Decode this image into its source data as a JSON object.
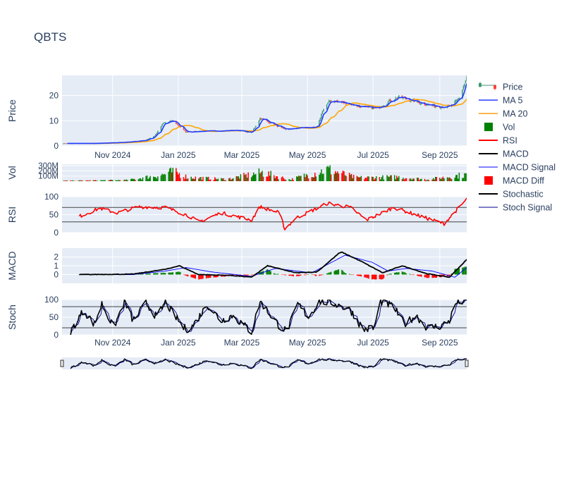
{
  "title": "QBTS",
  "colors": {
    "plot_bg": "#e5ecf6",
    "grid": "#ffffff",
    "text": "#2a3f5f",
    "up": "#3d9970",
    "down": "#ff4136",
    "ma5": "#1f3cff",
    "ma20": "#ffa500",
    "vol_up": "#008000",
    "vol_down": "#ff0000",
    "rsi": "#ff0000",
    "macd": "#000000",
    "macd_signal": "#0000ff",
    "stoch": "#000000",
    "stoch_signal": "#00008b"
  },
  "x_tick_labels": [
    "Nov 2024",
    "Jan 2025",
    "Mar 2025",
    "May 2025",
    "Jul 2025",
    "Sep 2025"
  ],
  "panels": {
    "price": {
      "ylabel": "Price",
      "ylim": [
        0,
        28
      ],
      "ticks": [
        {
          "v": 0,
          "label": "0"
        },
        {
          "v": 10,
          "label": "10"
        },
        {
          "v": 20,
          "label": "20"
        }
      ]
    },
    "vol": {
      "ylabel": "Vol",
      "ylim": [
        0,
        330
      ],
      "ticks": [
        {
          "v": 100,
          "label": "100M"
        },
        {
          "v": 200,
          "label": "200M"
        },
        {
          "v": 300,
          "label": "300M"
        }
      ]
    },
    "rsi": {
      "ylabel": "RSI",
      "ylim": [
        0,
        100
      ],
      "ticks": [
        {
          "v": 0,
          "label": "0"
        },
        {
          "v": 50,
          "label": "50"
        },
        {
          "v": 100,
          "label": "100"
        }
      ],
      "hlines": [
        30,
        70
      ]
    },
    "macd": {
      "ylabel": "MACD",
      "ylim": [
        -1,
        3
      ],
      "ticks": [
        {
          "v": 0,
          "label": "0"
        },
        {
          "v": 1,
          "label": "1"
        },
        {
          "v": 2,
          "label": "2"
        }
      ]
    },
    "stoch": {
      "ylabel": "Stoch",
      "ylim": [
        0,
        100
      ],
      "ticks": [
        {
          "v": 0,
          "label": "0"
        },
        {
          "v": 50,
          "label": "50"
        },
        {
          "v": 100,
          "label": "100"
        }
      ],
      "hlines": [
        20,
        80
      ]
    }
  },
  "legend": [
    {
      "label": "Price",
      "kind": "candle"
    },
    {
      "label": "MA 5",
      "kind": "line",
      "color": "#5a6cff",
      "width": 2
    },
    {
      "label": "MA 20",
      "kind": "line",
      "color": "#ffb34d",
      "width": 2
    },
    {
      "label": "Vol",
      "kind": "box",
      "color": "#008000"
    },
    {
      "label": "RSI",
      "kind": "line",
      "color": "#ff0000",
      "width": 2
    },
    {
      "label": "MACD",
      "kind": "line",
      "color": "#000000",
      "width": 2
    },
    {
      "label": "MACD Signal",
      "kind": "line",
      "color": "#0000ff",
      "width": 1
    },
    {
      "label": "MACD Diff",
      "kind": "box",
      "color": "#ff0000"
    },
    {
      "label": "Stochastic",
      "kind": "line",
      "color": "#000000",
      "width": 2
    },
    {
      "label": "Stoch Signal",
      "kind": "line",
      "color": "#00008b",
      "width": 1
    }
  ],
  "chart_data": {
    "type": "line",
    "title": "QBTS",
    "x_start": "2024-09-15",
    "x_end": "2025-09-26",
    "price_keypoints": [
      [
        "2024-09-15",
        1.0
      ],
      [
        "2024-10-15",
        1.0
      ],
      [
        "2024-11-10",
        1.4
      ],
      [
        "2024-12-01",
        2.2
      ],
      [
        "2024-12-10",
        4.0
      ],
      [
        "2024-12-18",
        9.0
      ],
      [
        "2024-12-27",
        10.0
      ],
      [
        "2025-01-08",
        5.5
      ],
      [
        "2025-01-20",
        5.8
      ],
      [
        "2025-02-10",
        6.0
      ],
      [
        "2025-02-25",
        6.2
      ],
      [
        "2025-03-10",
        5.2
      ],
      [
        "2025-03-18",
        11.0
      ],
      [
        "2025-03-28",
        9.0
      ],
      [
        "2025-04-10",
        6.5
      ],
      [
        "2025-04-25",
        7.3
      ],
      [
        "2025-05-10",
        7.3
      ],
      [
        "2025-05-15",
        14.0
      ],
      [
        "2025-05-22",
        18.0
      ],
      [
        "2025-06-05",
        17.0
      ],
      [
        "2025-06-20",
        15.5
      ],
      [
        "2025-07-05",
        15.0
      ],
      [
        "2025-07-15",
        17.5
      ],
      [
        "2025-07-25",
        19.5
      ],
      [
        "2025-08-10",
        17.5
      ],
      [
        "2025-08-20",
        16.5
      ],
      [
        "2025-09-01",
        15.5
      ],
      [
        "2025-09-12",
        16.0
      ],
      [
        "2025-09-19",
        19.0
      ],
      [
        "2025-09-26",
        27.0
      ]
    ],
    "volume_keypoints_millions": [
      [
        "2024-09-15",
        10
      ],
      [
        "2024-11-15",
        25
      ],
      [
        "2024-12-18",
        150
      ],
      [
        "2024-12-27",
        220
      ],
      [
        "2025-01-10",
        90
      ],
      [
        "2025-02-15",
        45
      ],
      [
        "2025-03-20",
        200
      ],
      [
        "2025-04-15",
        35
      ],
      [
        "2025-05-20",
        270
      ],
      [
        "2025-06-15",
        80
      ],
      [
        "2025-07-25",
        95
      ],
      [
        "2025-08-20",
        40
      ],
      [
        "2025-09-26",
        150
      ]
    ],
    "rsi_keypoints": [
      [
        "2024-10-01",
        45
      ],
      [
        "2024-10-20",
        68
      ],
      [
        "2024-11-05",
        55
      ],
      [
        "2024-11-25",
        72
      ],
      [
        "2024-12-20",
        70
      ],
      [
        "2025-01-10",
        48
      ],
      [
        "2025-01-20",
        30
      ],
      [
        "2025-02-10",
        55
      ],
      [
        "2025-03-10",
        35
      ],
      [
        "2025-03-18",
        72
      ],
      [
        "2025-04-05",
        55
      ],
      [
        "2025-04-10",
        10
      ],
      [
        "2025-04-20",
        40
      ],
      [
        "2025-05-20",
        82
      ],
      [
        "2025-06-10",
        70
      ],
      [
        "2025-06-25",
        35
      ],
      [
        "2025-07-20",
        70
      ],
      [
        "2025-08-20",
        40
      ],
      [
        "2025-09-05",
        25
      ],
      [
        "2025-09-26",
        93
      ]
    ],
    "macd_keypoints": [
      [
        "2024-10-01",
        0.0
      ],
      [
        "2024-11-20",
        0.05
      ],
      [
        "2024-12-20",
        0.6
      ],
      [
        "2025-01-02",
        1.0
      ],
      [
        "2025-01-20",
        0.0
      ],
      [
        "2025-02-20",
        -0.1
      ],
      [
        "2025-03-10",
        -0.3
      ],
      [
        "2025-03-25",
        1.0
      ],
      [
        "2025-04-20",
        0.2
      ],
      [
        "2025-05-10",
        0.3
      ],
      [
        "2025-06-01",
        2.6
      ],
      [
        "2025-06-20",
        1.5
      ],
      [
        "2025-07-10",
        0.2
      ],
      [
        "2025-07-28",
        1.0
      ],
      [
        "2025-08-20",
        0.1
      ],
      [
        "2025-09-10",
        -0.3
      ],
      [
        "2025-09-26",
        1.7
      ]
    ],
    "macd_signal_keypoints": [
      [
        "2024-10-01",
        0.0
      ],
      [
        "2024-11-20",
        0.0
      ],
      [
        "2024-12-20",
        0.4
      ],
      [
        "2025-01-08",
        0.8
      ],
      [
        "2025-02-01",
        0.3
      ],
      [
        "2025-03-10",
        -0.2
      ],
      [
        "2025-04-01",
        0.7
      ],
      [
        "2025-05-05",
        0.2
      ],
      [
        "2025-06-05",
        2.2
      ],
      [
        "2025-06-30",
        1.4
      ],
      [
        "2025-07-15",
        0.4
      ],
      [
        "2025-08-01",
        0.7
      ],
      [
        "2025-08-25",
        0.4
      ],
      [
        "2025-09-15",
        -0.3
      ],
      [
        "2025-09-26",
        0.8
      ]
    ],
    "stoch_keypoints": [
      [
        "2024-09-22",
        5
      ],
      [
        "2024-10-05",
        70
      ],
      [
        "2024-10-15",
        30
      ],
      [
        "2024-10-22",
        88
      ],
      [
        "2024-11-02",
        20
      ],
      [
        "2024-11-12",
        95
      ],
      [
        "2024-11-20",
        40
      ],
      [
        "2024-12-02",
        90
      ],
      [
        "2024-12-12",
        50
      ],
      [
        "2024-12-20",
        92
      ],
      [
        "2025-01-06",
        20
      ],
      [
        "2025-01-12",
        15
      ],
      [
        "2025-01-28",
        85
      ],
      [
        "2025-02-10",
        40
      ],
      [
        "2025-02-20",
        55
      ],
      [
        "2025-03-02",
        30
      ],
      [
        "2025-03-10",
        8
      ],
      [
        "2025-03-18",
        95
      ],
      [
        "2025-03-28",
        55
      ],
      [
        "2025-04-05",
        25
      ],
      [
        "2025-04-12",
        10
      ],
      [
        "2025-04-22",
        88
      ],
      [
        "2025-05-02",
        50
      ],
      [
        "2025-05-12",
        95
      ],
      [
        "2025-05-25",
        90
      ],
      [
        "2025-06-10",
        70
      ],
      [
        "2025-06-22",
        15
      ],
      [
        "2025-07-02",
        20
      ],
      [
        "2025-07-08",
        95
      ],
      [
        "2025-07-20",
        80
      ],
      [
        "2025-07-30",
        30
      ],
      [
        "2025-08-10",
        55
      ],
      [
        "2025-08-20",
        20
      ],
      [
        "2025-09-02",
        25
      ],
      [
        "2025-09-10",
        40
      ],
      [
        "2025-09-16",
        90
      ],
      [
        "2025-09-26",
        98
      ]
    ],
    "stoch_signal_lag_days": 3
  }
}
